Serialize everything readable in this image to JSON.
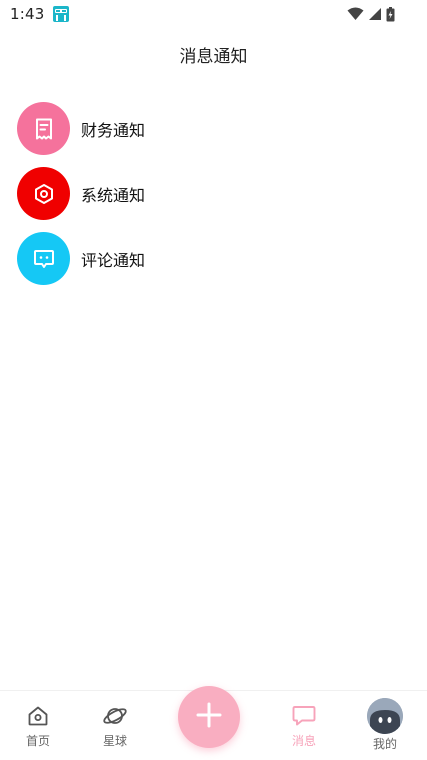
{
  "status_bar": {
    "time": "1:43"
  },
  "header": {
    "title": "消息通知"
  },
  "notifications": [
    {
      "label": "财务通知",
      "icon": "receipt-icon",
      "color": "#f5729c"
    },
    {
      "label": "系统通知",
      "icon": "hexagon-settings-icon",
      "color": "#f00000"
    },
    {
      "label": "评论通知",
      "icon": "chat-bubble-icon",
      "color": "#15c8f5"
    }
  ],
  "tab_bar": {
    "items": [
      {
        "label": "首页",
        "icon": "home-icon"
      },
      {
        "label": "星球",
        "icon": "planet-icon"
      },
      {
        "label": "消息",
        "icon": "message-icon",
        "active": true
      },
      {
        "label": "我的",
        "icon": "avatar"
      }
    ],
    "fab_icon": "plus-icon",
    "active_color": "#f7a3ba",
    "fab_color": "#f9aec1"
  }
}
